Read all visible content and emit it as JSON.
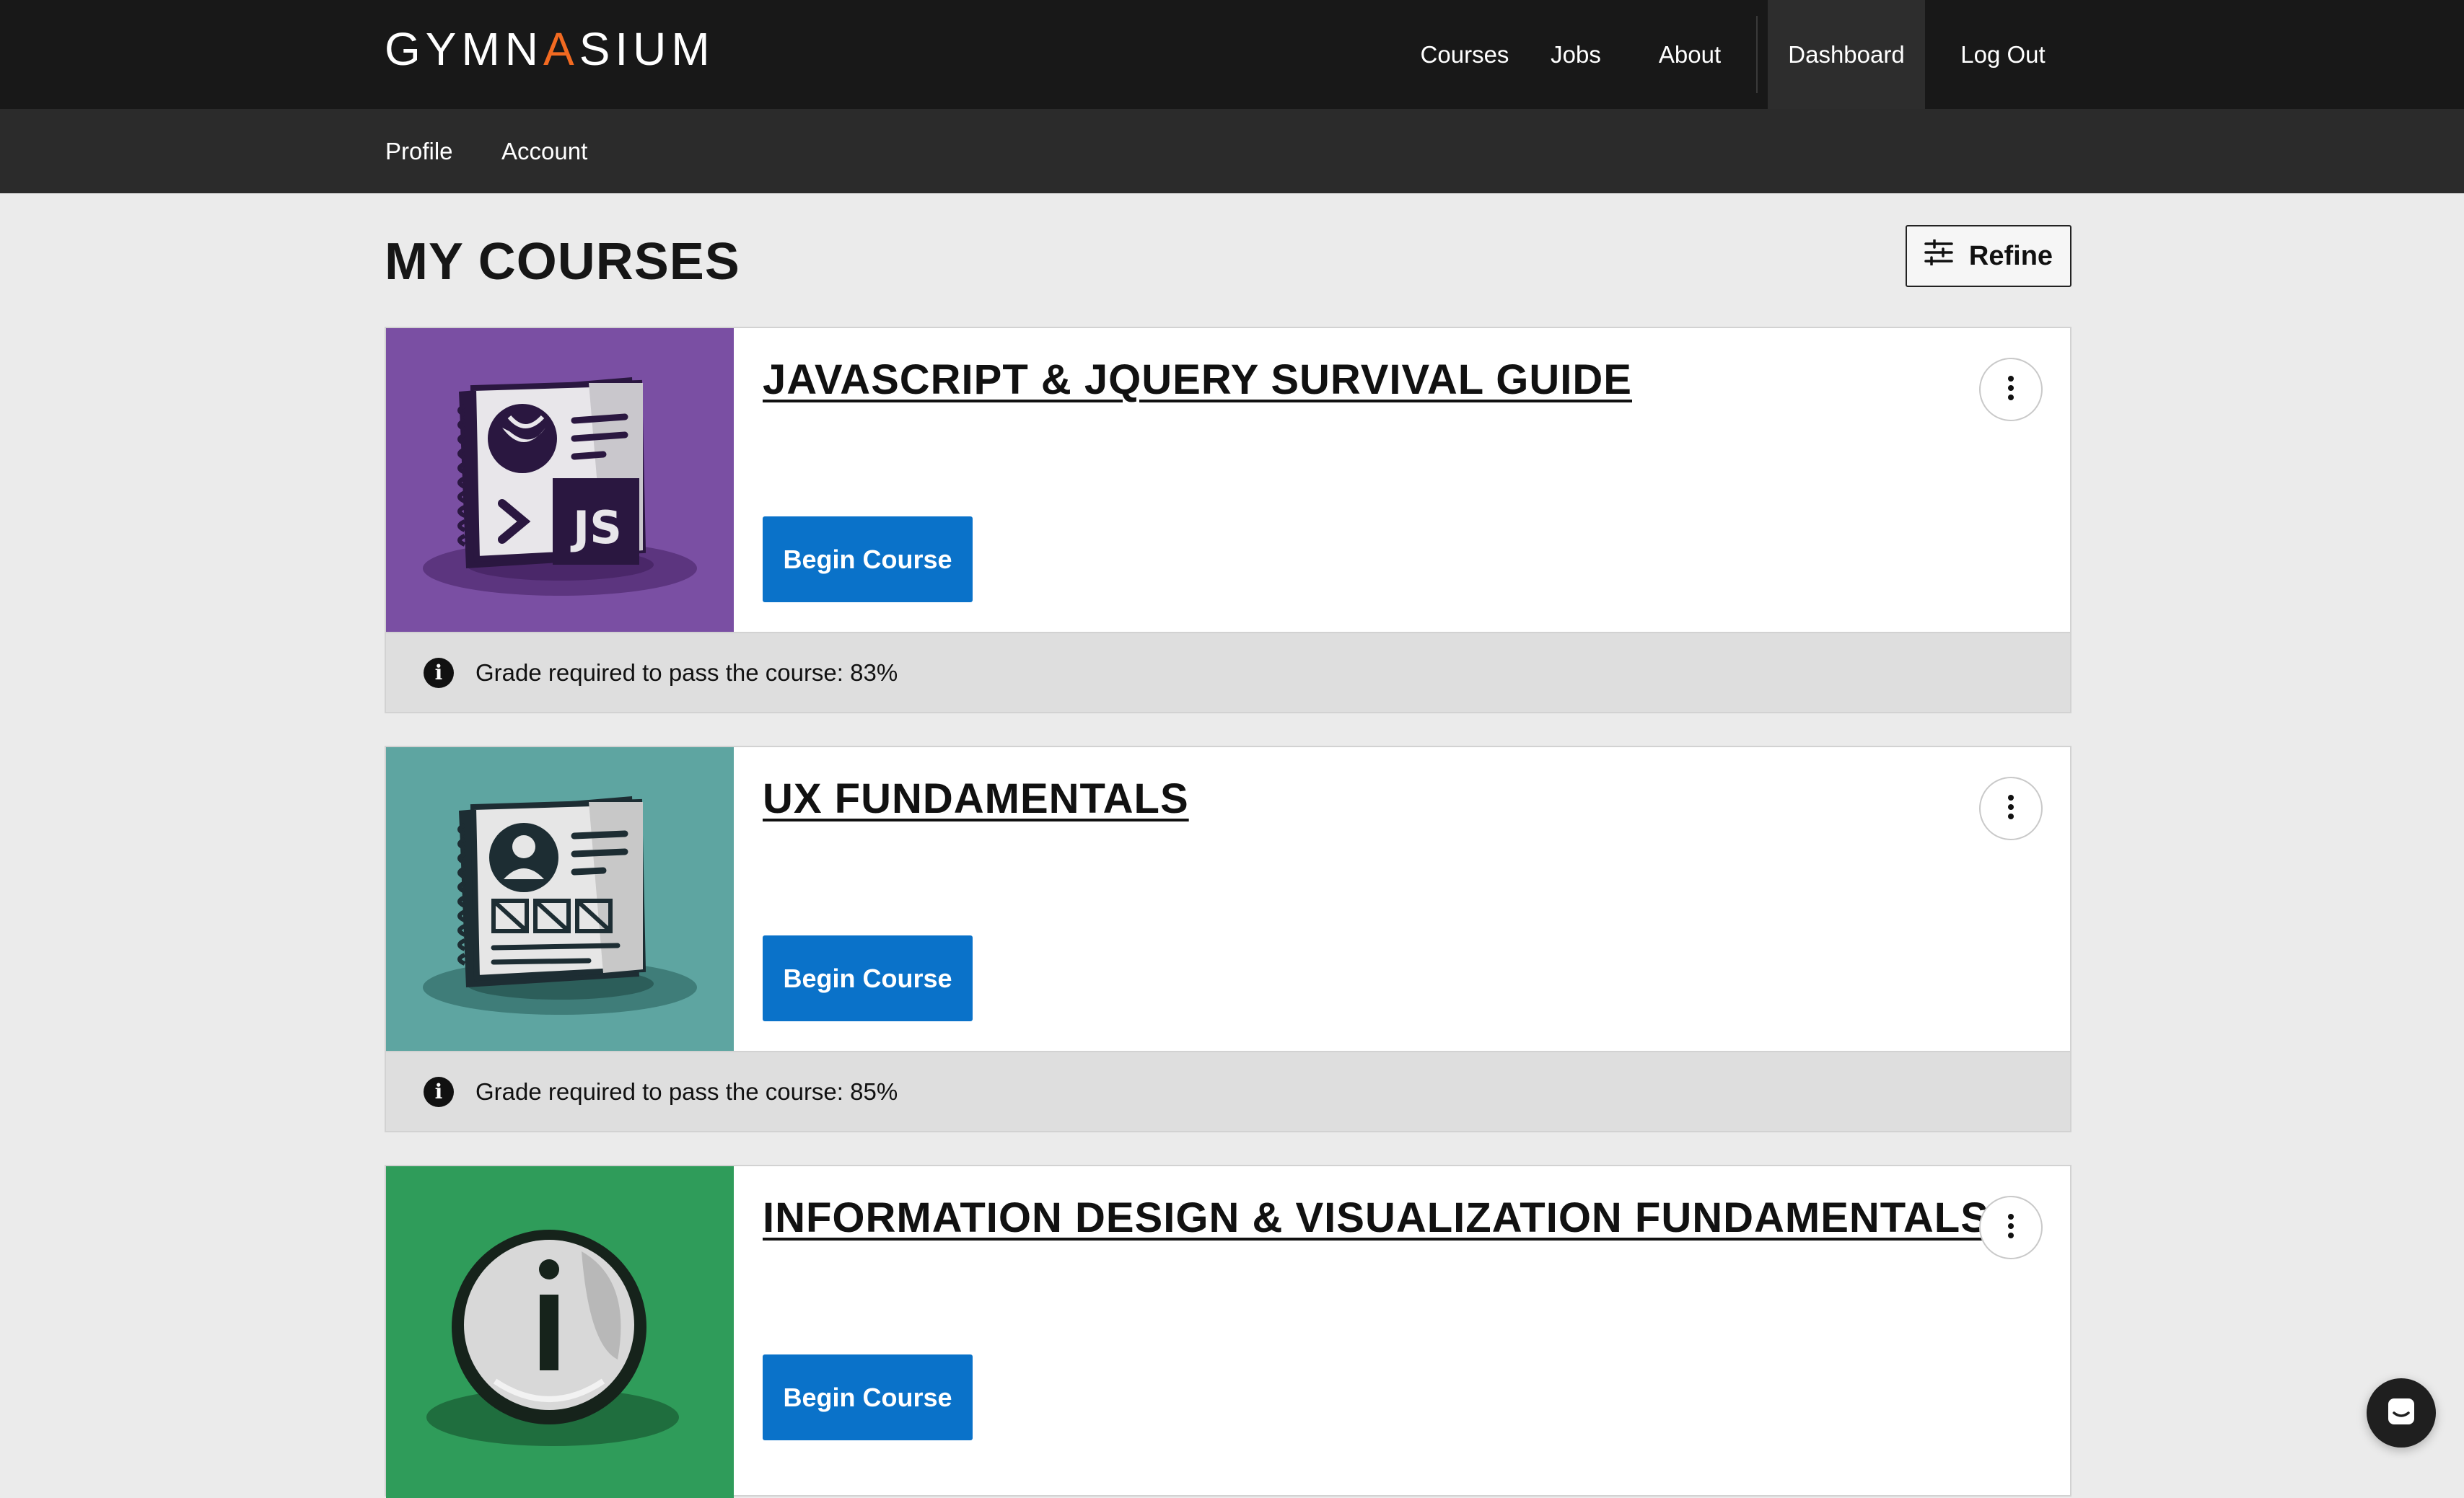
{
  "brand": {
    "logo_pre": "GYMN",
    "logo_accent": "A",
    "logo_post": "SIUM",
    "accent_color": "#f26a21"
  },
  "nav": {
    "courses": "Courses",
    "jobs": "Jobs",
    "about": "About",
    "dashboard": "Dashboard",
    "logout": "Log Out",
    "active": "Dashboard"
  },
  "subnav": {
    "profile": "Profile",
    "account": "Account"
  },
  "page": {
    "title": "MY COURSES",
    "refine_label": "Refine"
  },
  "courses": [
    {
      "title": "JAVASCRIPT & JQUERY SURVIVAL GUIDE",
      "button": "Begin Course",
      "grade_note": "Grade required to pass the course: 83%",
      "thumb_color": "#7a4fa3",
      "icon": "js-notebook-icon"
    },
    {
      "title": "UX FUNDAMENTALS",
      "button": "Begin Course",
      "grade_note": "Grade required to pass the course: 85%",
      "thumb_color": "#5ea5a1",
      "icon": "ux-notebook-icon"
    },
    {
      "title": "INFORMATION DESIGN & VISUALIZATION FUNDAMENTALS",
      "button": "Begin Course",
      "thumb_color": "#2f9c5a",
      "icon": "info-badge-icon"
    }
  ],
  "colors": {
    "primary_button": "#0a72c9",
    "topbar": "#181818",
    "subbar": "#2b2b2b"
  }
}
